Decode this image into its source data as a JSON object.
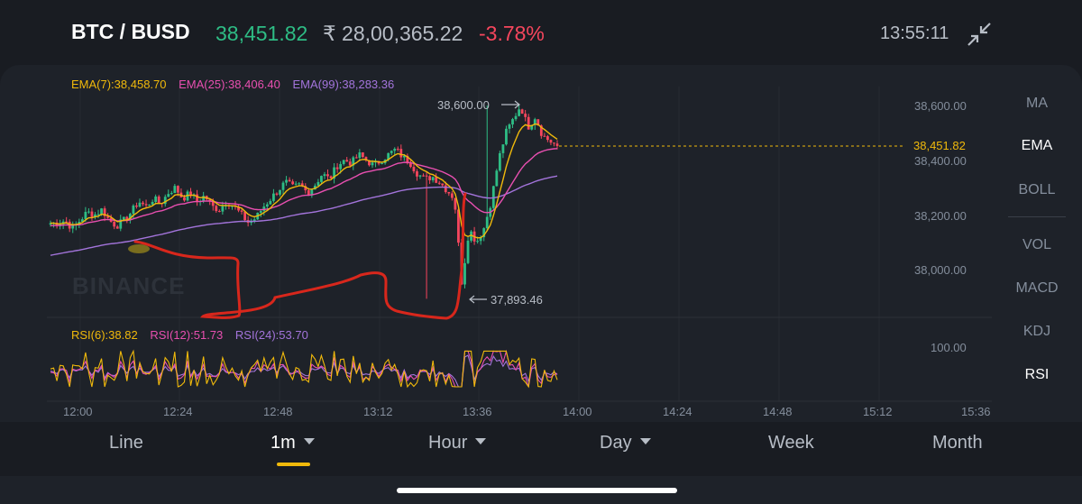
{
  "header": {
    "pair": "BTC / BUSD",
    "price": "38,451.82",
    "price_inr": "₹ 28,00,365.22",
    "change": "-3.78%",
    "time": "13:55:11",
    "collapse_icon": "collapse-arrows-icon"
  },
  "indicators": {
    "ema7": "EMA(7):38,458.70",
    "ema25": "EMA(25):38,406.40",
    "ema99": "EMA(99):38,283.36",
    "rsi6": "RSI(6):38.82",
    "rsi12": "RSI(12):51.73",
    "rsi24": "RSI(24):53.70"
  },
  "price_axis": [
    "38,600.00",
    "38,400.00",
    "38,200.00",
    "38,000.00"
  ],
  "current_price_label": "38,451.82",
  "high_label": "38,600.00",
  "low_label": "37,893.46",
  "rsi_axis": "100.00",
  "time_axis": [
    "12:00",
    "12:24",
    "12:48",
    "13:12",
    "13:36",
    "14:00",
    "14:24",
    "14:48",
    "15:12",
    "15:36"
  ],
  "watermark": "BINANCE",
  "side_menu": [
    "MA",
    "EMA",
    "BOLL",
    "VOL",
    "MACD",
    "KDJ",
    "RSI"
  ],
  "tabs": [
    {
      "label": "Line",
      "caret": false
    },
    {
      "label": "1m",
      "caret": true,
      "active": true
    },
    {
      "label": "Hour",
      "caret": true
    },
    {
      "label": "Day",
      "caret": true
    },
    {
      "label": "Week",
      "caret": false
    },
    {
      "label": "Month",
      "caret": false
    }
  ],
  "colors": {
    "up": "#2ebd85",
    "down": "#f6465d",
    "ema7": "#f0b90b",
    "ema25": "#e84fb0",
    "ema99": "#a374db",
    "annotation": "#d8271c"
  },
  "chart_data": {
    "type": "candlestick",
    "interval": "1m",
    "y_range": [
      37893.46,
      38600.0
    ],
    "close_path": [
      38170,
      38170,
      38180,
      38150,
      38180,
      38210,
      38200,
      38220,
      38180,
      38160,
      38180,
      38210,
      38250,
      38230,
      38260,
      38240,
      38280,
      38300,
      38260,
      38280,
      38250,
      38270,
      38230,
      38220,
      38250,
      38230,
      38200,
      38170,
      38190,
      38230,
      38260,
      38290,
      38320,
      38300,
      38310,
      38280,
      38310,
      38350,
      38330,
      38380,
      38400,
      38390,
      38420,
      38400,
      38380,
      38400,
      38420,
      38440,
      38410,
      38390,
      38350,
      38330,
      38340,
      38320,
      38290,
      38260,
      37950,
      38150,
      38100,
      38150,
      38250,
      38400,
      38500,
      38550,
      38600,
      38520,
      38560,
      38490,
      38470,
      38451.82
    ],
    "ema7": 38458.7,
    "ema25": 38406.4,
    "ema99": 38283.36,
    "rsi6": 38.82,
    "rsi12": 51.73,
    "rsi24": 53.7
  }
}
